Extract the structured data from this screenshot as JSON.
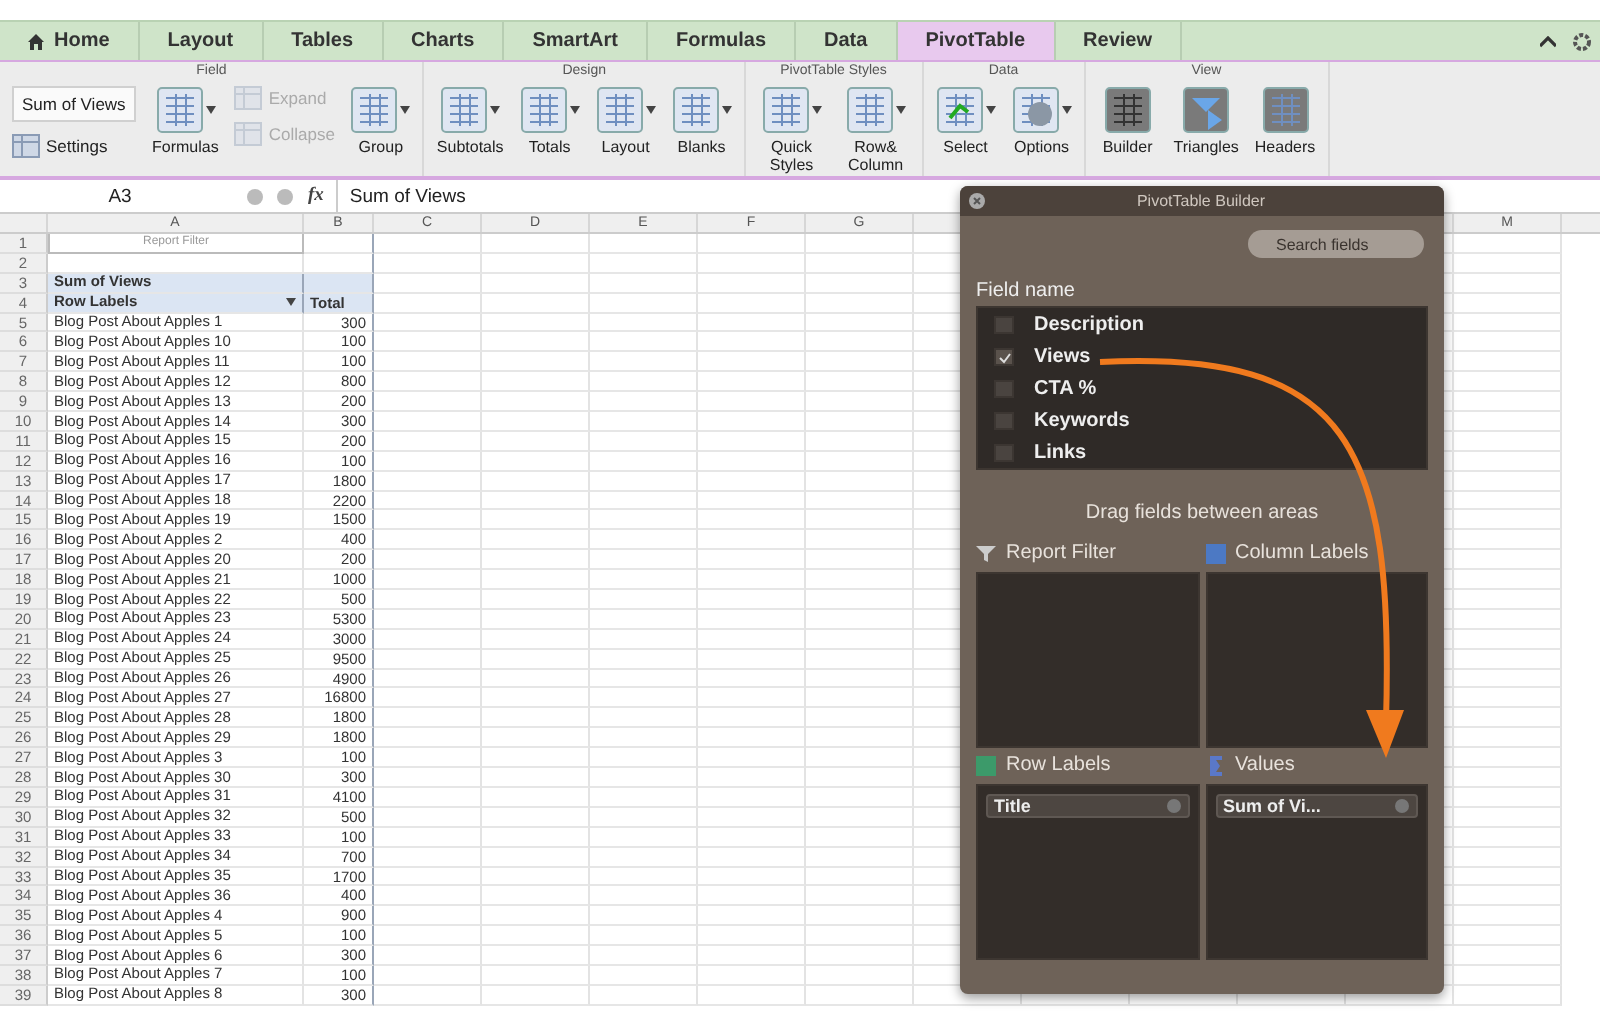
{
  "tabs": [
    {
      "label": "Home",
      "selected": false
    },
    {
      "label": "Layout",
      "selected": false
    },
    {
      "label": "Tables",
      "selected": false
    },
    {
      "label": "Charts",
      "selected": false
    },
    {
      "label": "SmartArt",
      "selected": false
    },
    {
      "label": "Formulas",
      "selected": false
    },
    {
      "label": "Data",
      "selected": false
    },
    {
      "label": "PivotTable",
      "selected": true
    },
    {
      "label": "Review",
      "selected": false
    }
  ],
  "ribbon": {
    "groups": [
      {
        "title": "Field",
        "controls": [
          {
            "kind": "field",
            "label": "Sum of Views"
          },
          {
            "kind": "small",
            "label": "Settings",
            "disabled": false
          },
          {
            "kind": "large",
            "label": "Formulas",
            "dropdown": true
          },
          {
            "kind": "small",
            "label": "Expand",
            "disabled": true
          },
          {
            "kind": "small",
            "label": "Collapse",
            "disabled": true
          },
          {
            "kind": "large",
            "label": "Group",
            "dropdown": true
          }
        ]
      },
      {
        "title": "Design",
        "controls": [
          {
            "kind": "large",
            "label": "Subtotals",
            "dropdown": true
          },
          {
            "kind": "large",
            "label": "Totals",
            "dropdown": true
          },
          {
            "kind": "large",
            "label": "Layout",
            "dropdown": true
          },
          {
            "kind": "large",
            "label": "Blanks",
            "dropdown": true
          }
        ]
      },
      {
        "title": "PivotTable Styles",
        "controls": [
          {
            "kind": "large",
            "label": "Quick Styles",
            "dropdown": true
          },
          {
            "kind": "large",
            "label": "Row& Column",
            "dropdown": true
          }
        ]
      },
      {
        "title": "Data",
        "controls": [
          {
            "kind": "large",
            "label": "Select",
            "dropdown": true
          },
          {
            "kind": "large",
            "label": "Options",
            "dropdown": true
          }
        ]
      },
      {
        "title": "View",
        "controls": [
          {
            "kind": "large",
            "label": "Builder",
            "dropdown": false
          },
          {
            "kind": "large",
            "label": "Triangles",
            "dropdown": false
          },
          {
            "kind": "large",
            "label": "Headers",
            "dropdown": false
          }
        ]
      }
    ]
  },
  "formula_bar": {
    "cell": "A3",
    "fx": "fx",
    "value": "Sum of Views"
  },
  "sheet": {
    "columns": [
      "A",
      "B",
      "C",
      "D",
      "E",
      "F",
      "G",
      "M"
    ],
    "rows": [
      {
        "num": "1",
        "kind": "filter",
        "a": "Report Filter"
      },
      {
        "num": "2",
        "kind": "empty"
      },
      {
        "num": "3",
        "kind": "title",
        "a": "Sum of Views"
      },
      {
        "num": "4",
        "kind": "labels",
        "a": "Row Labels",
        "b": "Total"
      },
      {
        "num": "5",
        "kind": "data",
        "a": "Blog Post About Apples 1",
        "b": "300"
      },
      {
        "num": "6",
        "kind": "data",
        "a": "Blog Post About Apples 10",
        "b": "100"
      },
      {
        "num": "7",
        "kind": "data",
        "a": "Blog Post About Apples 11",
        "b": "100"
      },
      {
        "num": "8",
        "kind": "data",
        "a": "Blog Post About Apples 12",
        "b": "800"
      },
      {
        "num": "9",
        "kind": "data",
        "a": "Blog Post About Apples 13",
        "b": "200"
      },
      {
        "num": "10",
        "kind": "data",
        "a": "Blog Post About Apples 14",
        "b": "300"
      },
      {
        "num": "11",
        "kind": "data",
        "a": "Blog Post About Apples 15",
        "b": "200"
      },
      {
        "num": "12",
        "kind": "data",
        "a": "Blog Post About Apples 16",
        "b": "100"
      },
      {
        "num": "13",
        "kind": "data",
        "a": "Blog Post About Apples 17",
        "b": "1800"
      },
      {
        "num": "14",
        "kind": "data",
        "a": "Blog Post About Apples 18",
        "b": "2200"
      },
      {
        "num": "15",
        "kind": "data",
        "a": "Blog Post About Apples 19",
        "b": "1500"
      },
      {
        "num": "16",
        "kind": "data",
        "a": "Blog Post About Apples 2",
        "b": "400"
      },
      {
        "num": "17",
        "kind": "data",
        "a": "Blog Post About Apples 20",
        "b": "200"
      },
      {
        "num": "18",
        "kind": "data",
        "a": "Blog Post About Apples 21",
        "b": "1000"
      },
      {
        "num": "19",
        "kind": "data",
        "a": "Blog Post About Apples 22",
        "b": "500"
      },
      {
        "num": "20",
        "kind": "data",
        "a": "Blog Post About Apples 23",
        "b": "5300"
      },
      {
        "num": "21",
        "kind": "data",
        "a": "Blog Post About Apples 24",
        "b": "3000"
      },
      {
        "num": "22",
        "kind": "data",
        "a": "Blog Post About Apples 25",
        "b": "9500"
      },
      {
        "num": "23",
        "kind": "data",
        "a": "Blog Post About Apples 26",
        "b": "4900"
      },
      {
        "num": "24",
        "kind": "data",
        "a": "Blog Post About Apples 27",
        "b": "16800"
      },
      {
        "num": "25",
        "kind": "data",
        "a": "Blog Post About Apples 28",
        "b": "1800"
      },
      {
        "num": "26",
        "kind": "data",
        "a": "Blog Post About Apples 29",
        "b": "1800"
      },
      {
        "num": "27",
        "kind": "data",
        "a": "Blog Post About Apples 3",
        "b": "100"
      },
      {
        "num": "28",
        "kind": "data",
        "a": "Blog Post About Apples 30",
        "b": "300"
      },
      {
        "num": "29",
        "kind": "data",
        "a": "Blog Post About Apples 31",
        "b": "4100"
      },
      {
        "num": "30",
        "kind": "data",
        "a": "Blog Post About Apples 32",
        "b": "500"
      },
      {
        "num": "31",
        "kind": "data",
        "a": "Blog Post About Apples 33",
        "b": "100"
      },
      {
        "num": "32",
        "kind": "data",
        "a": "Blog Post About Apples 34",
        "b": "700"
      },
      {
        "num": "33",
        "kind": "data",
        "a": "Blog Post About Apples 35",
        "b": "1700"
      },
      {
        "num": "34",
        "kind": "data",
        "a": "Blog Post About Apples 36",
        "b": "400"
      },
      {
        "num": "35",
        "kind": "data",
        "a": "Blog Post About Apples 4",
        "b": "900"
      },
      {
        "num": "36",
        "kind": "data",
        "a": "Blog Post About Apples 5",
        "b": "100"
      },
      {
        "num": "37",
        "kind": "data",
        "a": "Blog Post About Apples 6",
        "b": "300"
      },
      {
        "num": "38",
        "kind": "data",
        "a": "Blog Post About Apples 7",
        "b": "100"
      },
      {
        "num": "39",
        "kind": "data",
        "a": "Blog Post About Apples 8",
        "b": "300"
      }
    ]
  },
  "builder": {
    "title": "PivotTable Builder",
    "search": {
      "placeholder": "Search fields"
    },
    "field_label": "Field name",
    "fields": [
      {
        "name": "Description",
        "checked": false
      },
      {
        "name": "Views",
        "checked": true
      },
      {
        "name": "CTA %",
        "checked": false
      },
      {
        "name": "Keywords",
        "checked": false
      },
      {
        "name": "Links",
        "checked": false
      }
    ],
    "hint": "Drag fields between areas",
    "areas": [
      {
        "label": "Report Filter"
      },
      {
        "label": "Column Labels"
      },
      {
        "label": "Row Labels",
        "items": [
          "Title"
        ]
      },
      {
        "label": "Values",
        "items": [
          "Sum of Vi..."
        ]
      }
    ]
  }
}
